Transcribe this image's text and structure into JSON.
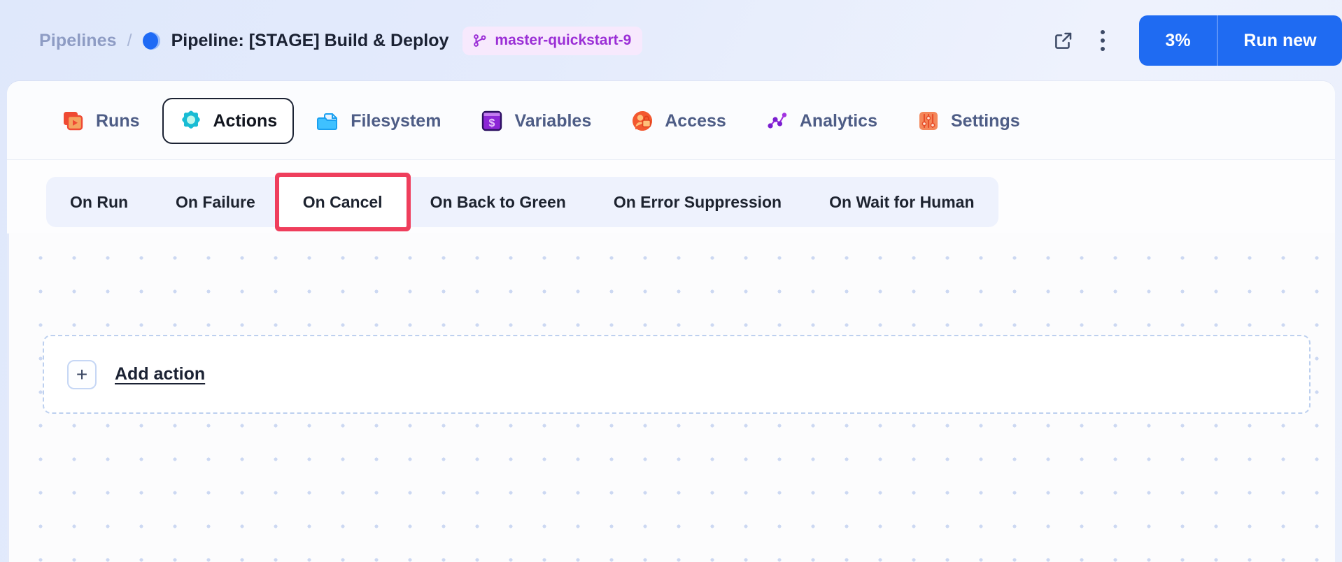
{
  "header": {
    "breadcrumb_root": "Pipelines",
    "breadcrumb_separator": "/",
    "status_icon": "pipeline-status-dot",
    "title": "Pipeline: [STAGE] Build & Deploy",
    "branch": {
      "icon": "git-branch-icon",
      "label": "master-quickstart-9"
    },
    "open_external_icon": "external-link-icon",
    "more_menu_icon": "kebab-menu-icon",
    "run_percent": "3%",
    "run_new_label": "Run new"
  },
  "tabs": [
    {
      "label": "Runs",
      "icon": "runs-icon",
      "active": false
    },
    {
      "label": "Actions",
      "icon": "actions-gear-icon",
      "active": true
    },
    {
      "label": "Filesystem",
      "icon": "filesystem-folder-icon",
      "active": false
    },
    {
      "label": "Variables",
      "icon": "variables-dollar-icon",
      "active": false
    },
    {
      "label": "Access",
      "icon": "access-lock-icon",
      "active": false
    },
    {
      "label": "Analytics",
      "icon": "analytics-nodes-icon",
      "active": false
    },
    {
      "label": "Settings",
      "icon": "settings-sliders-icon",
      "active": false
    }
  ],
  "subtabs": [
    {
      "label": "On Run",
      "selected": false,
      "highlight": false
    },
    {
      "label": "On Failure",
      "selected": false,
      "highlight": false
    },
    {
      "label": "On Cancel",
      "selected": true,
      "highlight": true
    },
    {
      "label": "On Back to Green",
      "selected": false,
      "highlight": false
    },
    {
      "label": "On Error Suppression",
      "selected": false,
      "highlight": false
    },
    {
      "label": "On Wait for Human",
      "selected": false,
      "highlight": false
    }
  ],
  "canvas": {
    "add_action_plus": "+",
    "add_action_label": "Add action"
  },
  "colors": {
    "accent_blue": "#1f6bf2",
    "highlight_red": "#ef3e5c",
    "branch_purple": "#9b2fd6",
    "tab_text": "#4e5d86"
  }
}
